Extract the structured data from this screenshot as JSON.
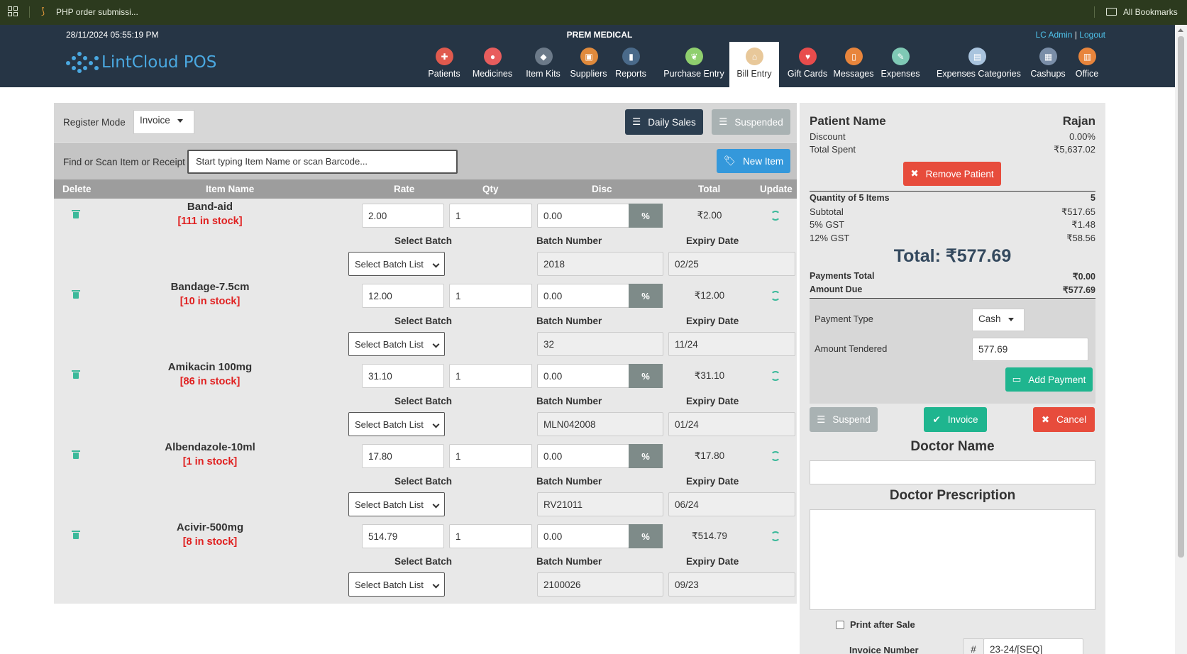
{
  "browser": {
    "tab_title": "PHP order submissi...",
    "bookmarks_label": "All Bookmarks"
  },
  "header": {
    "datetime": "28/11/2024 05:55:19 PM",
    "store_name": "PREM MEDICAL",
    "user": "LC Admin",
    "separator": "|",
    "logout": "Logout"
  },
  "logo": {
    "text": "LintCloud POS"
  },
  "menu": [
    {
      "label": "Patients",
      "icon": "patients-icon",
      "color": "#e05a4e"
    },
    {
      "label": "Medicines",
      "icon": "medicines-icon",
      "color": "#e85d5d"
    },
    {
      "label": "Item Kits",
      "icon": "item-kits-icon",
      "color": "#6c7a89"
    },
    {
      "label": "Suppliers",
      "icon": "suppliers-icon",
      "color": "#e08a3c"
    },
    {
      "label": "Reports",
      "icon": "reports-icon",
      "color": "#4a6a8a"
    },
    {
      "label": "Purchase Entry",
      "icon": "purchase-entry-icon",
      "color": "#8fcf6e"
    },
    {
      "label": "Bill Entry",
      "icon": "bill-entry-icon",
      "color": "#e8c89a"
    },
    {
      "label": "Gift Cards",
      "icon": "gift-cards-icon",
      "color": "#e84c4c"
    },
    {
      "label": "Messages",
      "icon": "messages-icon",
      "color": "#e8853c"
    },
    {
      "label": "Expenses",
      "icon": "expenses-icon",
      "color": "#7fc9b5"
    },
    {
      "label": "Expenses Categories",
      "icon": "expenses-categories-icon",
      "color": "#a9c4de"
    },
    {
      "label": "Cashups",
      "icon": "cashups-icon",
      "color": "#7a8ea8"
    },
    {
      "label": "Office",
      "icon": "office-icon",
      "color": "#e8853c"
    }
  ],
  "register": {
    "mode_label": "Register Mode",
    "mode_value": "Invoice",
    "daily_sales": "Daily Sales",
    "suspended": "Suspended"
  },
  "find": {
    "label": "Find or Scan Item or Receipt",
    "placeholder": "Start typing Item Name or scan Barcode...",
    "new_item": "New Item"
  },
  "table": {
    "headers": {
      "delete": "Delete",
      "item_name": "Item Name",
      "rate": "Rate",
      "qty": "Qty",
      "disc": "Disc",
      "total": "Total",
      "update": "Update"
    },
    "sub_headers": {
      "select_batch": "Select Batch",
      "batch_number": "Batch Number",
      "expiry_date": "Expiry Date",
      "select_batch_list": "Select Batch List",
      "percent": "%"
    },
    "items": [
      {
        "name": "Band-aid",
        "stock": "[111 in stock]",
        "rate": "2.00",
        "qty": "1",
        "disc": "0.00",
        "total": "₹2.00",
        "batch": "2018",
        "expiry": "02/25"
      },
      {
        "name": "Bandage-7.5cm",
        "stock": "[10 in stock]",
        "rate": "12.00",
        "qty": "1",
        "disc": "0.00",
        "total": "₹12.00",
        "batch": "32",
        "expiry": "11/24"
      },
      {
        "name": "Amikacin 100mg",
        "stock": "[86 in stock]",
        "rate": "31.10",
        "qty": "1",
        "disc": "0.00",
        "total": "₹31.10",
        "batch": "MLN042008",
        "expiry": "01/24"
      },
      {
        "name": "Albendazole-10ml",
        "stock": "[1 in stock]",
        "rate": "17.80",
        "qty": "1",
        "disc": "0.00",
        "total": "₹17.80",
        "batch": "RV21011",
        "expiry": "06/24"
      },
      {
        "name": "Acivir-500mg",
        "stock": "[8 in stock]",
        "rate": "514.79",
        "qty": "1",
        "disc": "0.00",
        "total": "₹514.79",
        "batch": "2100026",
        "expiry": "09/23"
      }
    ]
  },
  "summary": {
    "patient_label": "Patient Name",
    "patient_name": "Rajan",
    "discount_label": "Discount",
    "discount": "0.00%",
    "total_spent_label": "Total Spent",
    "total_spent": "₹5,637.02",
    "remove_patient": "Remove Patient",
    "qty_label": "Quantity of 5 Items",
    "qty": "5",
    "subtotal_label": "Subtotal",
    "subtotal": "₹517.65",
    "gst5_label": "5% GST",
    "gst5": "₹1.48",
    "gst12_label": "12% GST",
    "gst12": "₹58.56",
    "total": "Total: ₹577.69",
    "payments_total_label": "Payments Total",
    "payments_total": "₹0.00",
    "amount_due_label": "Amount Due",
    "amount_due": "₹577.69",
    "payment_type_label": "Payment Type",
    "payment_type": "Cash",
    "amount_tendered_label": "Amount Tendered",
    "amount_tendered": "577.69",
    "add_payment": "Add Payment",
    "suspend": "Suspend",
    "invoice": "Invoice",
    "cancel": "Cancel",
    "doctor_name_label": "Doctor Name",
    "doctor_prescription_label": "Doctor Prescription",
    "print_after_sale": "Print after Sale",
    "invoice_number_label": "Invoice Number",
    "invoice_hash": "#",
    "invoice_number": "23-24/[SEQ]"
  },
  "colors": {
    "nav": "#263545",
    "bookmarks_bar": "#2c3a1e",
    "accent_blue": "#3498db",
    "green": "#1fb58f",
    "red": "#e74c3c",
    "dark_btn": "#2c3e50"
  }
}
